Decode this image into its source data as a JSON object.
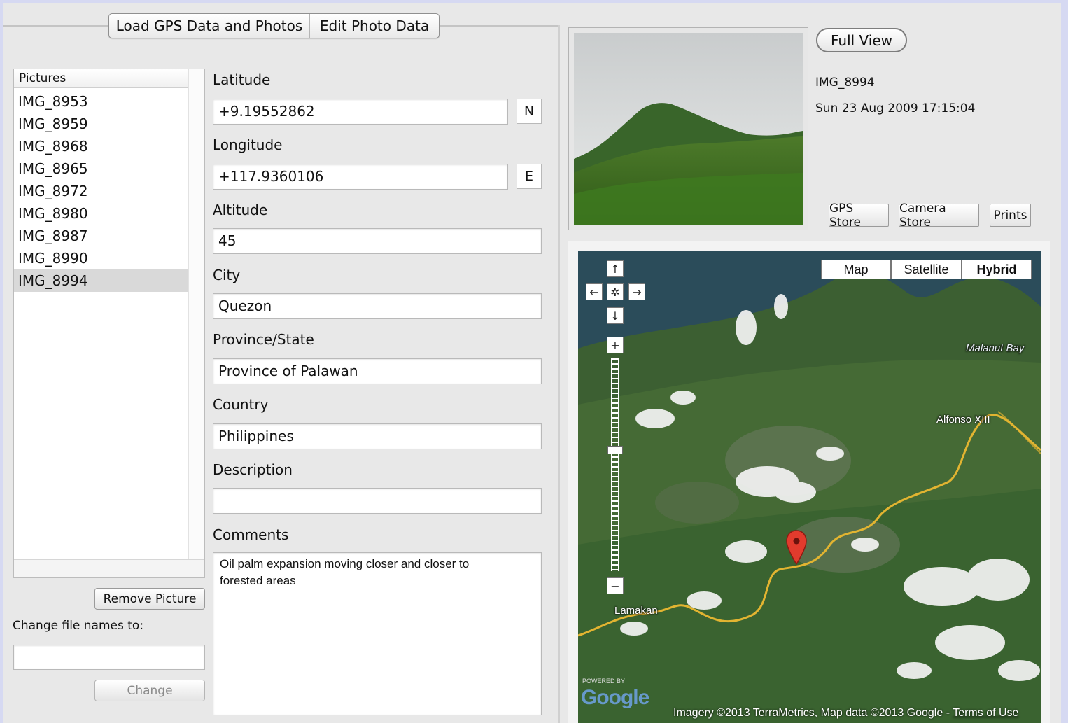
{
  "tabs": [
    "Load GPS Data and Photos",
    "Edit Photo Data"
  ],
  "pictures": {
    "header": "Pictures",
    "items": [
      "IMG_8953",
      "IMG_8959",
      "IMG_8968",
      "IMG_8965",
      "IMG_8972",
      "IMG_8980",
      "IMG_8987",
      "IMG_8990",
      "IMG_8994"
    ],
    "selected": "IMG_8994"
  },
  "actions": {
    "remove_picture": "Remove Picture",
    "change_names_label": "Change file names to:",
    "change_names_value": "",
    "change": "Change"
  },
  "form": {
    "latitude_label": "Latitude",
    "latitude": "+9.19552862",
    "latitude_hemi": "N",
    "longitude_label": "Longitude",
    "longitude": "+117.9360106",
    "longitude_hemi": "E",
    "altitude_label": "Altitude",
    "altitude": "45",
    "city_label": "City",
    "city": "Quezon",
    "province_label": "Province/State",
    "province": "Province of Palawan",
    "country_label": "Country",
    "country": "Philippines",
    "description_label": "Description",
    "description": "",
    "comments_label": "Comments",
    "comments": "Oil palm expansion moving closer and closer to forested areas"
  },
  "photo": {
    "full_view": "Full View",
    "name": "IMG_8994",
    "date": "Sun 23 Aug 2009 17:15:04",
    "gps_store": "GPS Store",
    "camera_store": "Camera Store",
    "prints": "Prints"
  },
  "map": {
    "types": [
      "Map",
      "Satellite",
      "Hybrid"
    ],
    "active_type": "Hybrid",
    "labels": {
      "bay": "Malanut Bay",
      "town1": "Alfonso XIII",
      "town2": "Lamakan"
    },
    "logo_small": "POWERED BY",
    "logo": "Google",
    "copyright": "Imagery ©2013 TerraMetrics, Map data ©2013 Google - ",
    "terms": "Terms of Use",
    "zoom_level": 0.43,
    "colors": {
      "road": "#e2b431",
      "marker": "#e23b2d"
    }
  }
}
